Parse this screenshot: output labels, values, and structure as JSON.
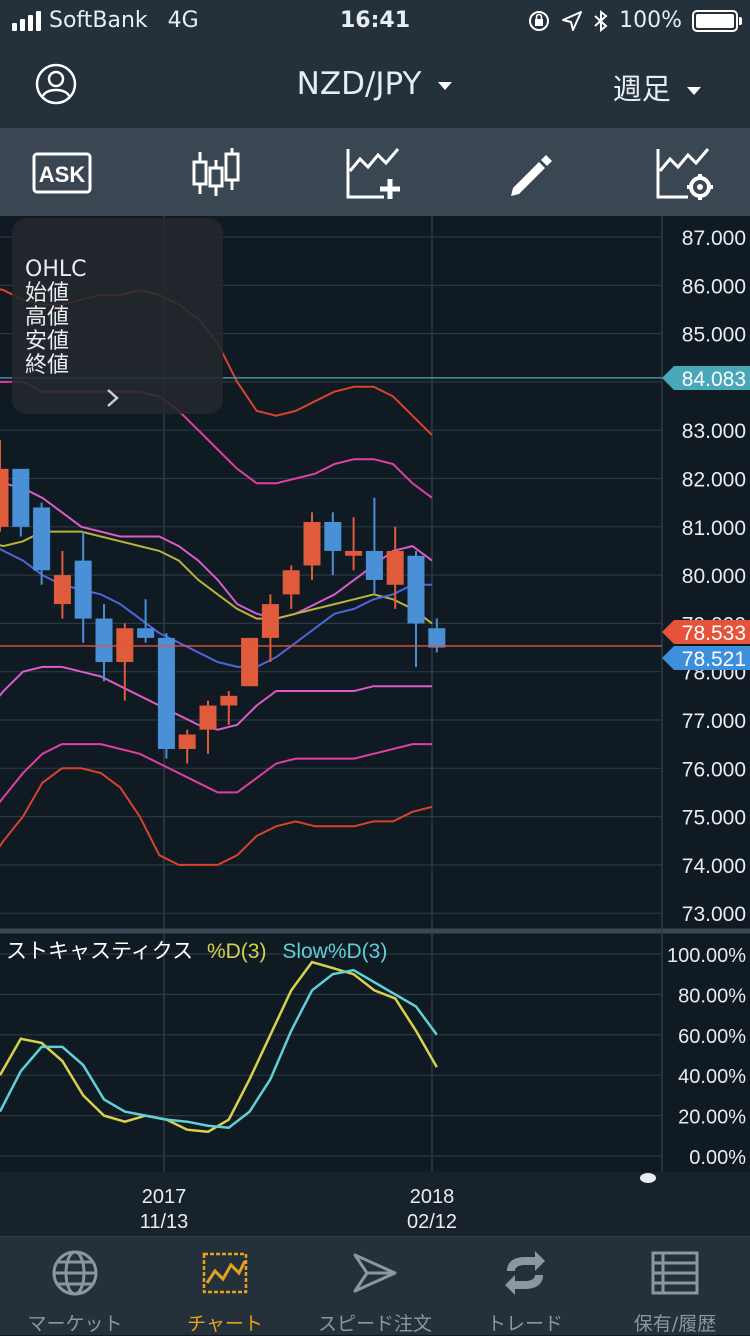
{
  "status_bar": {
    "carrier": "SoftBank",
    "network": "4G",
    "time": "16:41",
    "battery": "100%"
  },
  "header": {
    "symbol": "NZD/JPY",
    "period": "週足",
    "account_icon": "user-circle-icon"
  },
  "toolbar": {
    "ask_label": "ASK",
    "tools": [
      "ask-toggle-icon",
      "candlestick-type-icon",
      "add-indicator-icon",
      "draw-pencil-icon",
      "indicator-settings-icon"
    ]
  },
  "ohlc_panel": {
    "title": "OHLC",
    "open_label": "始値",
    "high_label": "高値",
    "low_label": "安値",
    "close_label": "終値"
  },
  "price_axis": {
    "ticks": [
      "87.000",
      "86.000",
      "85.000",
      "83.000",
      "82.000",
      "81.000",
      "80.000",
      "77.000",
      "76.000",
      "75.000",
      "74.000",
      "73.000"
    ],
    "hidden_ticks": [
      "79.000",
      "78.000"
    ],
    "ask_value": "78.533",
    "bid_value": "78.521",
    "level_value": "84.083"
  },
  "date_axis": [
    {
      "year": "2017",
      "date": "11/13"
    },
    {
      "year": "2018",
      "date": "02/12"
    }
  ],
  "stochastic": {
    "name": "ストキャスティクス",
    "d_label": "%D(3)",
    "slow_label": "Slow%D(3)",
    "ticks": [
      "100.00%",
      "80.00%",
      "60.00%",
      "40.00%",
      "20.00%",
      "0.00%"
    ]
  },
  "colors": {
    "up": "#e05a3c",
    "down": "#4a90d6",
    "ask_tag": "#e5533b",
    "bid_tag": "#3d8fdc",
    "level_tag": "#48a7b8",
    "stoch_d": "#d8d24a",
    "stoch_slow": "#5fd0d8",
    "accent": "#e7a21b"
  },
  "chart_data": {
    "type": "candlestick",
    "ylim": [
      73,
      87
    ],
    "candles": [
      {
        "o": 81.0,
        "h": 82.8,
        "l": 80.9,
        "c": 82.2
      },
      {
        "o": 82.2,
        "h": 82.2,
        "l": 80.8,
        "c": 81.0
      },
      {
        "o": 81.4,
        "h": 81.5,
        "l": 79.8,
        "c": 80.1
      },
      {
        "o": 79.4,
        "h": 80.5,
        "l": 79.1,
        "c": 80.0
      },
      {
        "o": 80.3,
        "h": 80.9,
        "l": 78.6,
        "c": 79.1
      },
      {
        "o": 79.1,
        "h": 79.4,
        "l": 77.8,
        "c": 78.2
      },
      {
        "o": 78.2,
        "h": 79.0,
        "l": 77.4,
        "c": 78.9
      },
      {
        "o": 78.9,
        "h": 79.5,
        "l": 78.6,
        "c": 78.7
      },
      {
        "o": 78.7,
        "h": 78.8,
        "l": 76.2,
        "c": 76.4
      },
      {
        "o": 76.4,
        "h": 76.8,
        "l": 76.1,
        "c": 76.7
      },
      {
        "o": 76.8,
        "h": 77.4,
        "l": 76.3,
        "c": 77.3
      },
      {
        "o": 77.3,
        "h": 77.6,
        "l": 76.9,
        "c": 77.5
      },
      {
        "o": 77.7,
        "h": 78.7,
        "l": 77.7,
        "c": 78.7
      },
      {
        "o": 78.7,
        "h": 79.6,
        "l": 78.2,
        "c": 79.4
      },
      {
        "o": 79.6,
        "h": 80.2,
        "l": 79.3,
        "c": 80.1
      },
      {
        "o": 80.2,
        "h": 81.3,
        "l": 79.9,
        "c": 81.1
      },
      {
        "o": 81.1,
        "h": 81.3,
        "l": 80.0,
        "c": 80.5
      },
      {
        "o": 80.4,
        "h": 81.2,
        "l": 80.1,
        "c": 80.5
      },
      {
        "o": 80.5,
        "h": 81.6,
        "l": 79.6,
        "c": 79.9
      },
      {
        "o": 79.8,
        "h": 81.0,
        "l": 79.3,
        "c": 80.5
      },
      {
        "o": 80.4,
        "h": 80.5,
        "l": 78.1,
        "c": 79.0
      },
      {
        "o": 78.9,
        "h": 79.1,
        "l": 78.4,
        "c": 78.5
      }
    ],
    "bands": {
      "outer_upper": [
        86.0,
        85.9,
        85.7,
        85.6,
        85.6,
        85.7,
        85.8,
        85.8,
        85.9,
        85.8,
        85.6,
        85.3,
        84.8,
        84.0,
        83.4,
        83.3,
        83.4,
        83.6,
        83.8,
        83.9,
        83.9,
        83.7,
        83.3,
        82.9
      ],
      "inner_upper": [
        84.0,
        84.0,
        84.0,
        83.8,
        83.8,
        83.8,
        83.8,
        83.8,
        83.8,
        83.7,
        83.4,
        83.0,
        82.6,
        82.2,
        81.9,
        81.9,
        82.0,
        82.1,
        82.3,
        82.4,
        82.4,
        82.3,
        81.9,
        81.6
      ],
      "mid_upper": [
        82.0,
        81.9,
        81.8,
        81.6,
        81.3,
        81.0,
        80.9,
        80.8,
        80.8,
        80.8,
        80.6,
        80.3,
        79.9,
        79.4,
        79.2,
        79.1,
        79.2,
        79.4,
        79.6,
        79.9,
        80.2,
        80.5,
        80.6,
        80.3
      ],
      "ma_long": [
        80.7,
        80.6,
        80.7,
        80.9,
        80.9,
        80.9,
        80.8,
        80.7,
        80.6,
        80.5,
        80.3,
        79.9,
        79.6,
        79.3,
        79.1,
        79.1,
        79.2,
        79.3,
        79.4,
        79.5,
        79.6,
        79.5,
        79.3,
        79.0
      ],
      "ma_short": [
        80.7,
        80.5,
        80.3,
        80.0,
        79.8,
        79.7,
        79.6,
        79.4,
        79.1,
        78.8,
        78.6,
        78.4,
        78.2,
        78.1,
        78.1,
        78.3,
        78.6,
        78.9,
        79.2,
        79.3,
        79.5,
        79.6,
        79.8,
        79.8
      ],
      "mid_lower": [
        77.1,
        77.6,
        78.0,
        78.1,
        78.1,
        78.0,
        77.9,
        77.7,
        77.5,
        77.3,
        77.1,
        76.9,
        76.8,
        76.9,
        77.3,
        77.6,
        77.6,
        77.6,
        77.6,
        77.6,
        77.7,
        77.7,
        77.7,
        77.7
      ],
      "inner_lower": [
        74.9,
        75.4,
        75.9,
        76.3,
        76.5,
        76.5,
        76.5,
        76.4,
        76.3,
        76.1,
        75.9,
        75.7,
        75.5,
        75.5,
        75.8,
        76.1,
        76.2,
        76.2,
        76.2,
        76.2,
        76.3,
        76.4,
        76.5,
        76.5
      ],
      "outer_lower": [
        73.9,
        74.5,
        75.0,
        75.7,
        76.0,
        76.0,
        75.9,
        75.6,
        75.0,
        74.2,
        74.0,
        74.0,
        74.0,
        74.2,
        74.6,
        74.8,
        74.9,
        74.8,
        74.8,
        74.8,
        74.9,
        74.9,
        75.1,
        75.2
      ]
    },
    "stoch_d": [
      40,
      58,
      56,
      47,
      30,
      20,
      17,
      20,
      18,
      13,
      12,
      18,
      38,
      60,
      82,
      96,
      93,
      90,
      82,
      78,
      62,
      44
    ],
    "stoch_slow": [
      22,
      42,
      54,
      54,
      45,
      28,
      22,
      20,
      18,
      17,
      15,
      14,
      22,
      38,
      62,
      82,
      90,
      92,
      86,
      80,
      74,
      60
    ],
    "stoch_ylim": [
      0,
      100
    ]
  }
}
